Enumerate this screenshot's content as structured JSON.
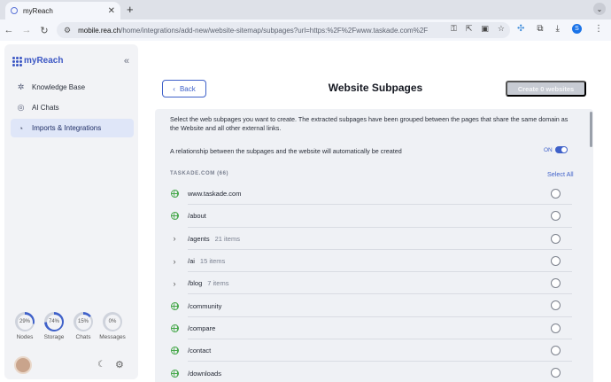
{
  "browser": {
    "tab_title": "myReach",
    "url_host": "mobile.rea.ch",
    "url_rest": "/home/integrations/add-new/website-sitemap/subpages?url=https:%2F%2Fwww.taskade.com%2F",
    "profile_initial": "S"
  },
  "sidebar": {
    "brand": "myReach",
    "items": [
      {
        "label": "Knowledge Base",
        "icon": "knowledge-icon",
        "active": false
      },
      {
        "label": "AI Chats",
        "icon": "ai-chat-icon",
        "active": false
      },
      {
        "label": "Imports & Integrations",
        "icon": "integrations-icon",
        "active": true
      }
    ],
    "usage": [
      {
        "label": "Nodes",
        "value": "29%",
        "fraction": 0.29
      },
      {
        "label": "Storage",
        "value": "74%",
        "fraction": 0.74
      },
      {
        "label": "Chats",
        "value": "15%",
        "fraction": 0.15
      },
      {
        "label": "Messages",
        "value": "0%",
        "fraction": 0.0
      }
    ]
  },
  "header": {
    "back_label": "Back",
    "title": "Website Subpages",
    "create_label": "Create 0 websites"
  },
  "panel": {
    "intro": "Select the web subpages you want to create. The extracted subpages have been grouped between the pages that share the same domain as the Website and all other external links.",
    "relation_text": "A relationship between the subpages and the website will automatically be created",
    "toggle_label": "ON",
    "group_title": "TASKADE.COM (66)",
    "select_all": "Select All"
  },
  "rows": [
    {
      "path": "www.taskade.com",
      "type": "page",
      "count": ""
    },
    {
      "path": "/about",
      "type": "page",
      "count": ""
    },
    {
      "path": "/agents",
      "type": "group",
      "count": "21 items"
    },
    {
      "path": "/ai",
      "type": "group",
      "count": "15 items"
    },
    {
      "path": "/blog",
      "type": "group",
      "count": "7 items"
    },
    {
      "path": "/community",
      "type": "page",
      "count": ""
    },
    {
      "path": "/compare",
      "type": "page",
      "count": ""
    },
    {
      "path": "/contact",
      "type": "page",
      "count": ""
    },
    {
      "path": "/downloads",
      "type": "page",
      "count": ""
    }
  ],
  "colors": {
    "accent": "#3f61c9",
    "globe": "#47a84b"
  }
}
